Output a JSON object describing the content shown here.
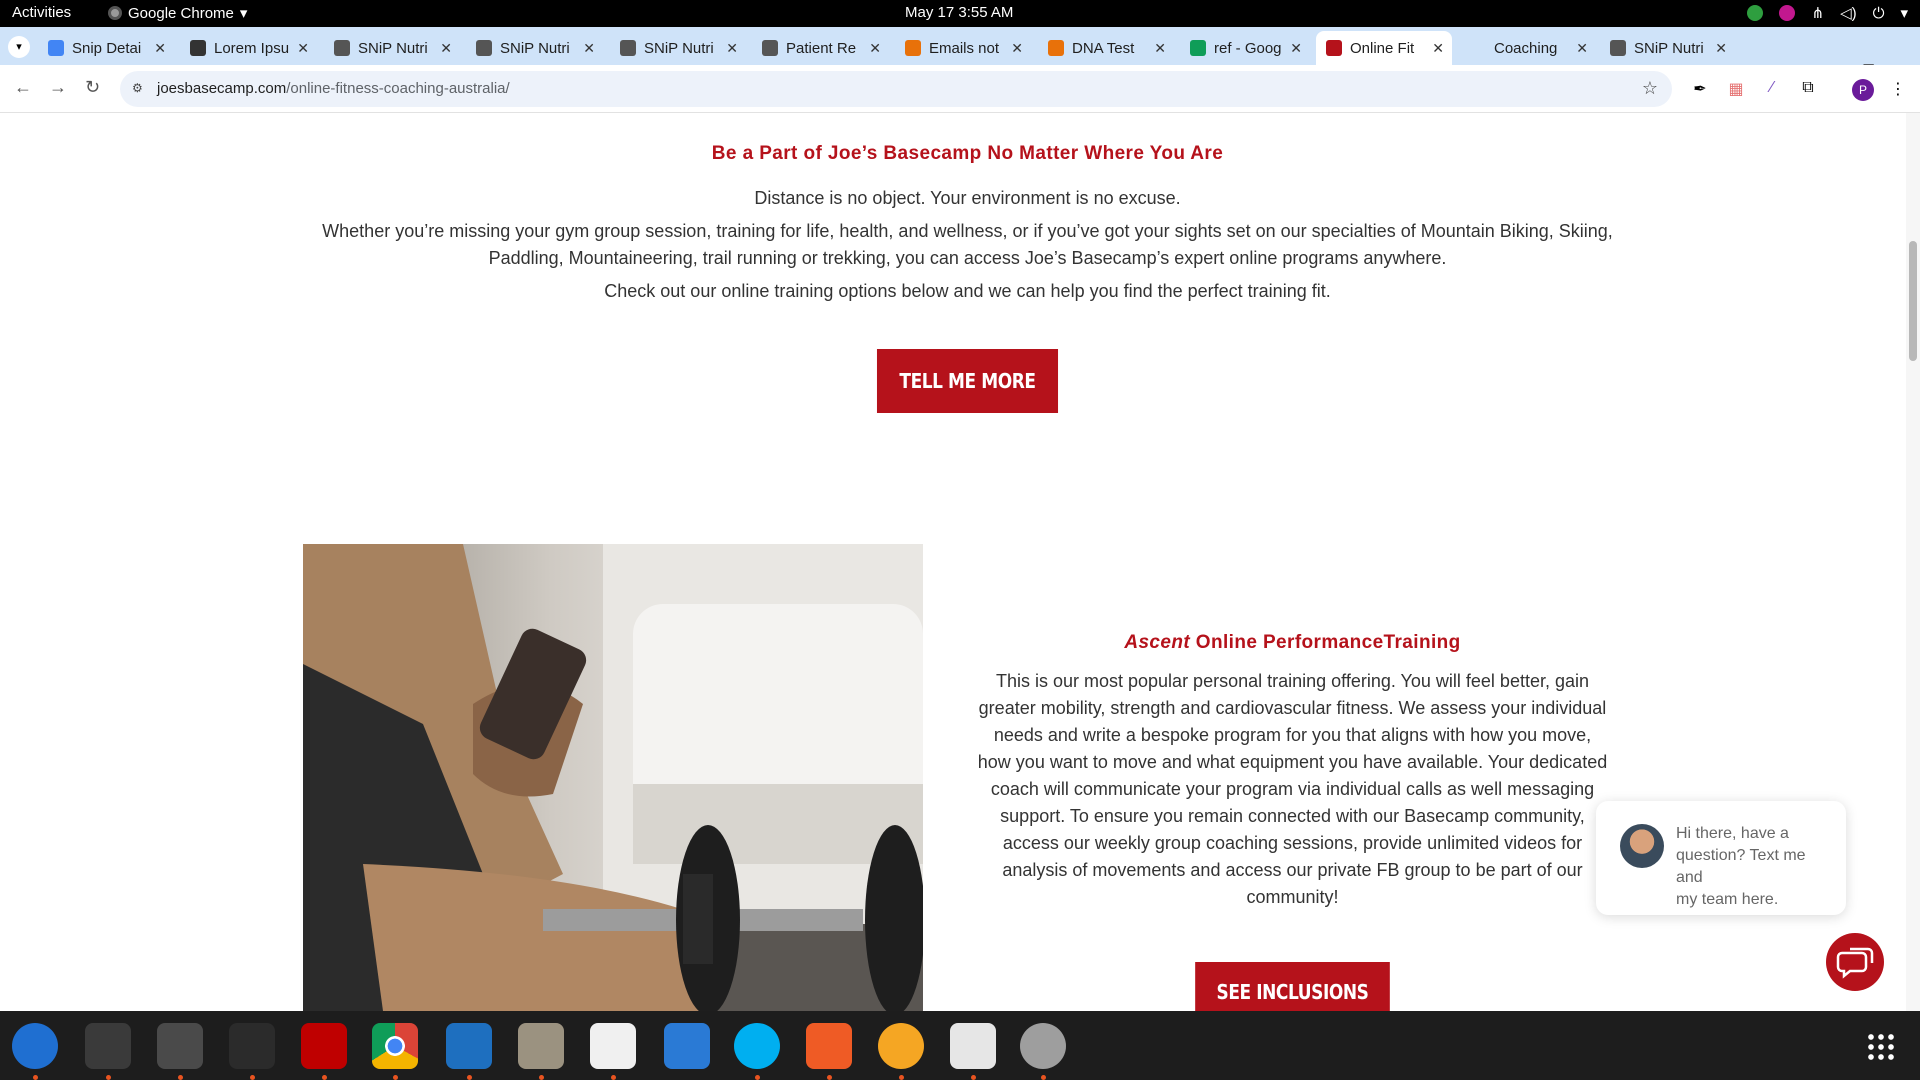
{
  "system": {
    "activities": "Activities",
    "app_name": "Google Chrome",
    "clock": "May 17  3:55 AM"
  },
  "tabs": [
    {
      "title": "Snip Detai",
      "icon": "docs-icon",
      "color": "#4285f4"
    },
    {
      "title": "Lorem Ipsu",
      "icon": "lorem-icon",
      "color": "#333333"
    },
    {
      "title": "SNiP Nutri",
      "icon": "snip-icon",
      "color": "#555555"
    },
    {
      "title": "SNiP Nutri",
      "icon": "snip-icon",
      "color": "#555555"
    },
    {
      "title": "SNiP Nutri",
      "icon": "snip-icon",
      "color": "#555555"
    },
    {
      "title": "Patient Re",
      "icon": "snip-icon",
      "color": "#555555"
    },
    {
      "title": "Emails not",
      "icon": "mail-icon",
      "color": "#e8710a"
    },
    {
      "title": "DNA Test",
      "icon": "mail-icon",
      "color": "#e8710a"
    },
    {
      "title": "ref - Goog",
      "icon": "sheets-icon",
      "color": "#0f9d58"
    },
    {
      "title": "Online Fit",
      "icon": "lips-icon",
      "color": "#b5121b",
      "active": true
    },
    {
      "title": "Coaching",
      "icon": "blank-icon",
      "color": "#cfe3f9"
    },
    {
      "title": "SNiP Nutri",
      "icon": "snip-icon",
      "color": "#555555"
    }
  ],
  "address_bar": {
    "domain": "joesbasecamp.com",
    "path": "/online-fitness-coaching-australia/"
  },
  "profile_initial": "P",
  "section1": {
    "heading": "Be a Part of Joe’s Basecamp No Matter Where You Are",
    "line1": "Distance is no object. Your environment is no excuse.",
    "line2a": "Whether you’re missing your gym group session, training for life, health, and wellness, or if you’ve got your sights set on our specialties of Mountain Biking, Skiing,",
    "line2b": "Paddling, Mountaineering, trail running or trekking, you can access Joe’s Basecamp’s expert online programs anywhere.",
    "line3": "Check out our online training options below and we can help you find the perfect training fit.",
    "button": "TELL ME MORE"
  },
  "section2": {
    "heading_italic": "Ascent",
    "heading_rest": " Online PerformanceTraining",
    "body": [
      "This is our most popular personal training offering. You will feel better, gain",
      "greater mobility, strength and cardiovascular fitness. We assess your individual",
      "needs  and write a bespoke program for you that aligns with how you move,",
      "how you want to move and what equipment you have available. Your dedicated",
      "coach will communicate your program via individual calls as well messaging",
      "support. To ensure you remain connected with our Basecamp community,",
      "access our weekly group coaching sessions, provide unlimited videos for",
      "analysis of movements and access our private FB group to be part of our",
      "community!"
    ],
    "button": "SEE INCLUSIONS"
  },
  "chat": {
    "message_lines": [
      "Hi there, have a",
      "question? Text me and",
      "my team here."
    ]
  },
  "dock": [
    {
      "name": "thunderbird-icon",
      "color": "#1f6fd1",
      "running": true
    },
    {
      "name": "terminal-icon",
      "color": "#3a3a3a",
      "running": true
    },
    {
      "name": "calculator-icon",
      "color": "#4a4a4a",
      "running": true
    },
    {
      "name": "system-monitor-icon",
      "color": "#2b2b2b",
      "running": true
    },
    {
      "name": "filezilla-icon",
      "color": "#bf0000",
      "running": true
    },
    {
      "name": "chrome-icon",
      "color": "#dddddd",
      "running": true
    },
    {
      "name": "vscode-icon",
      "color": "#1e6fbf",
      "running": true
    },
    {
      "name": "files-icon",
      "color": "#9b9280",
      "running": true
    },
    {
      "name": "text-editor-icon",
      "color": "#f0f0f0",
      "running": true
    },
    {
      "name": "libreoffice-writer-icon",
      "color": "#2a7ad5",
      "running": false
    },
    {
      "name": "skype-icon",
      "color": "#00aff0",
      "running": true
    },
    {
      "name": "postman-icon",
      "color": "#ef5b25",
      "running": true
    },
    {
      "name": "blender-fire-icon",
      "color": "#f5a623",
      "running": true
    },
    {
      "name": "document-viewer-icon",
      "color": "#e6e6e6",
      "running": true
    },
    {
      "name": "disk-icon",
      "color": "#9e9e9e",
      "running": true
    }
  ]
}
